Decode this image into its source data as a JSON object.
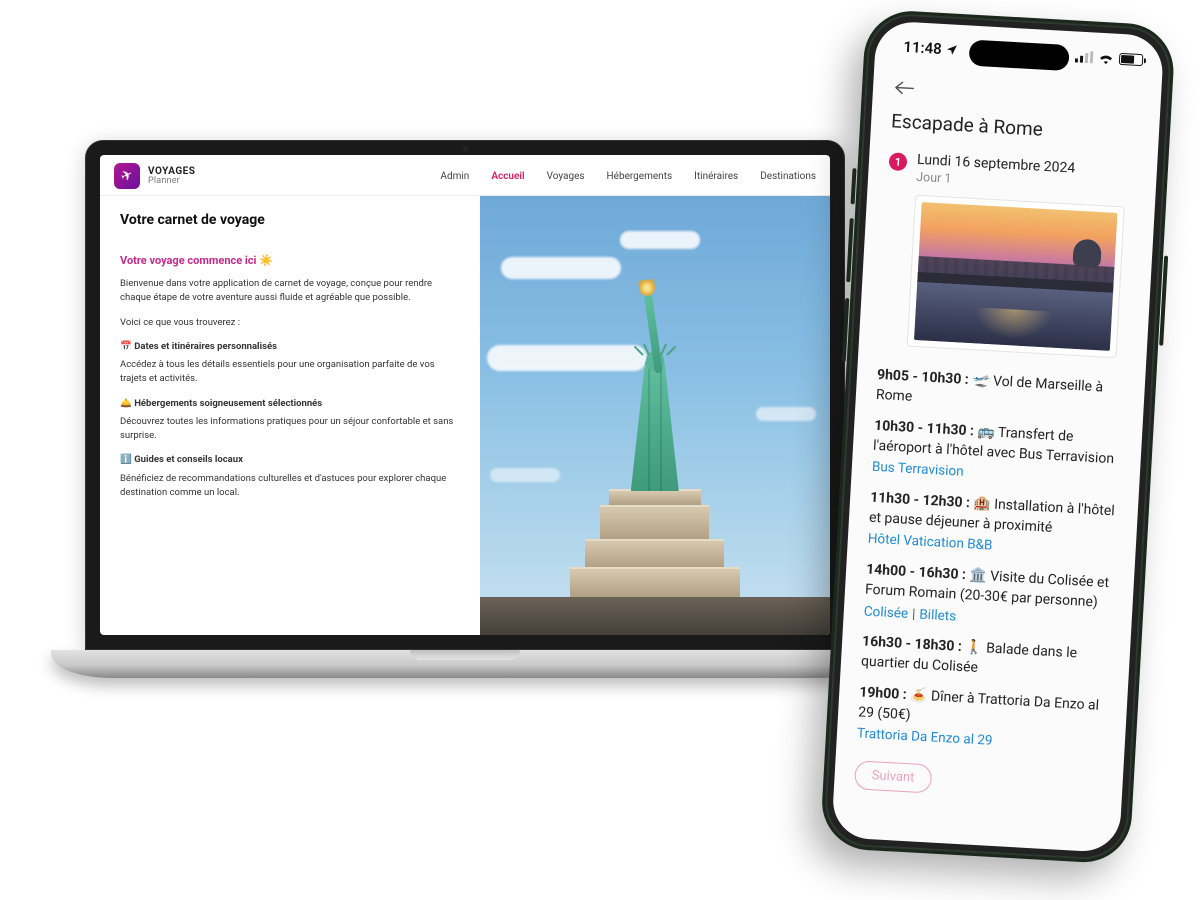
{
  "laptop": {
    "brand": {
      "name": "VOYAGES",
      "sub": "Planner"
    },
    "nav": {
      "items": [
        "Admin",
        "Accueil",
        "Voyages",
        "Hébergements",
        "Itinéraires",
        "Destinations"
      ],
      "active_index": 1
    },
    "content": {
      "h1": "Votre carnet de voyage",
      "h2": "Votre voyage commence ici ☀️",
      "welcome_1": "Bienvenue dans votre application de carnet de voyage, conçue pour rendre chaque étape de votre aventure aussi fluide et agréable que possible.",
      "welcome_2": "Voici ce que vous trouverez :",
      "feat1_t": "📅 Dates et itinéraires personnalisés",
      "feat1_b": "Accédez à tous les détails essentiels pour une organisation parfaite de vos trajets et activités.",
      "feat2_t": "🛎️ Hébergements soigneusement sélectionnés",
      "feat2_b": "Découvrez toutes les informations pratiques pour un séjour confortable et sans surprise.",
      "feat3_t": "ℹ️ Guides et conseils locaux",
      "feat3_b": "Bénéficiez de recommandations culturelles et d'astuces pour explorer chaque destination comme un local."
    }
  },
  "phone": {
    "status": {
      "time": "11:48"
    },
    "title": "Escapade à Rome",
    "day": {
      "num": "1",
      "date": "Lundi 16 septembre 2024",
      "sub": "Jour 1"
    },
    "itin": [
      {
        "time": "9h05 - 10h30 :",
        "emoji": "🛫",
        "text": " Vol de Marseille à Rome"
      },
      {
        "time": "10h30 - 11h30 :",
        "emoji": "🚌",
        "text": " Transfert de l'aéroport à l'hôtel avec Bus Terravision",
        "link": "Bus Terravision"
      },
      {
        "time": "11h30 - 12h30 :",
        "emoji": "🏨",
        "text": " Installation à l'hôtel et pause déjeuner à proximité",
        "link": "Hôtel Vatication B&B"
      },
      {
        "time": "14h00 - 16h30 :",
        "emoji": "🏛️",
        "text": " Visite du Colisée et Forum Romain (20-30€ par personne)",
        "link1": "Colisée",
        "link2": "Billets"
      },
      {
        "time": "16h30 - 18h30 :",
        "emoji": "🚶",
        "text": " Balade dans le quartier du Colisée"
      },
      {
        "time": "19h00 :",
        "emoji": "🍝",
        "text": " Dîner à Trattoria Da Enzo al 29 (50€)",
        "link": "Trattoria Da Enzo al 29"
      }
    ],
    "next_label": "Suivant"
  }
}
